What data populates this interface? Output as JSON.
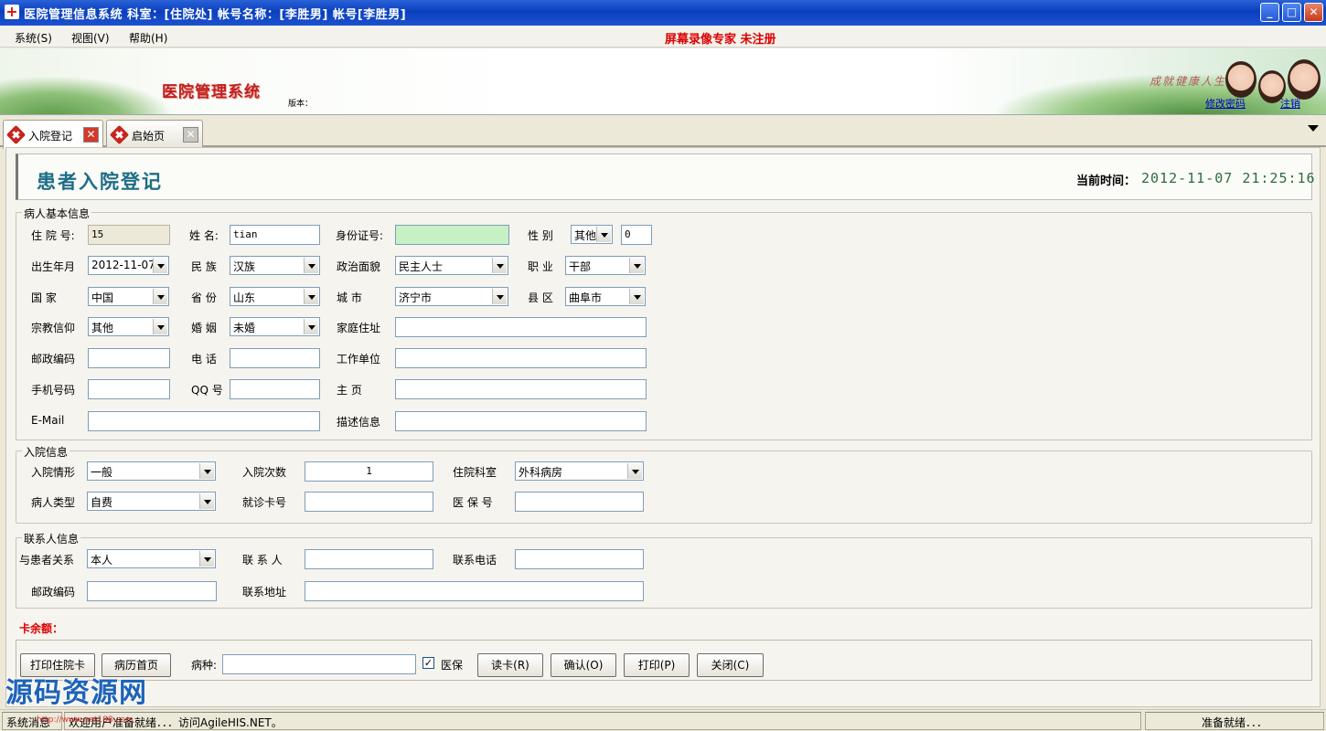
{
  "window": {
    "title": "医院管理信息系统  科室：[住院处]  帐号名称：[李胜男]  帐号[李胜男]",
    "minimize": "_",
    "maximize": "□",
    "close": "✕"
  },
  "menu": {
    "items": [
      "系统(S)",
      "视图(V)",
      "帮助(H)"
    ],
    "watermark": "屏幕录像专家  未注册"
  },
  "banner": {
    "app_title": "医院管理系统",
    "version_label": "版本：",
    "slogan": "成就健康人生",
    "change_password": "修改密码",
    "logout": "注销"
  },
  "tabs": [
    {
      "label": "入院登记",
      "active": true
    },
    {
      "label": "启始页",
      "active": false
    }
  ],
  "header": {
    "title": "患者入院登记",
    "time_label": "当前时间：",
    "time_value": "2012-11-07 21:25:16"
  },
  "patient": {
    "group_label": "病人基本信息",
    "inpatient_no_label": "住 院 号:",
    "inpatient_no": "15",
    "name_label": "姓 名:",
    "name": "tian",
    "id_card_label": "身份证号:",
    "id_card": "",
    "gender_label": "性 别",
    "gender": "其他",
    "gender_code": "0",
    "birth_label": "出生年月",
    "birth": "2012-11-07",
    "ethnic_label": "民 族",
    "ethnic": "汉族",
    "political_label": "政治面貌",
    "political": "民主人士",
    "job_label": "职 业",
    "job": "干部",
    "country_label": "国     家",
    "country": "中国",
    "province_label": "省 份",
    "province": "山东",
    "city_label": "城     市",
    "city": "济宁市",
    "county_label": "县 区",
    "county": "曲阜市",
    "religion_label": "宗教信仰",
    "religion": "其他",
    "marriage_label": "婚 姻",
    "marriage": "未婚",
    "address_label": "家庭住址",
    "postcode_label": "邮政编码",
    "phone_label": "电 话",
    "work_label": "工作单位",
    "mobile_label": "手机号码",
    "qq_label": "QQ 号",
    "homepage_label": "主     页",
    "email_label": "E-Mail",
    "desc_label": "描述信息"
  },
  "admission": {
    "group_label": "入院信息",
    "situation_label": "入院情形",
    "situation": "一般",
    "times_label": "入院次数",
    "times": "1",
    "dept_label": "住院科室",
    "dept": "外科病房",
    "type_label": "病人类型",
    "type": "自费",
    "card_label": "就诊卡号",
    "insurance_label": "医 保 号"
  },
  "contact": {
    "group_label": "联系人信息",
    "relation_label": "与患者关系",
    "relation": "本人",
    "person_label": "联 系 人",
    "phone_label": "联系电话",
    "postcode_label": "邮政编码",
    "address_label": "联系地址"
  },
  "footer": {
    "card_balance_label": "卡余额：",
    "print_card": "打印住院卡",
    "case_home": "病历首页",
    "disease_label": "病种:",
    "insurance_check": "✓",
    "insurance_label": "医保",
    "read_card": "读卡(R)",
    "confirm": "确认(O)",
    "print": "打印(P)",
    "close": "关闭(C)"
  },
  "status": {
    "label": "系统消息",
    "message": "欢迎用户准备就绪．．．访问AgileHIS.NET。",
    "right": "准备就绪．．．"
  },
  "overlay": {
    "logo_text": "源码资源网",
    "logo_url": "http://www.net188.com"
  }
}
